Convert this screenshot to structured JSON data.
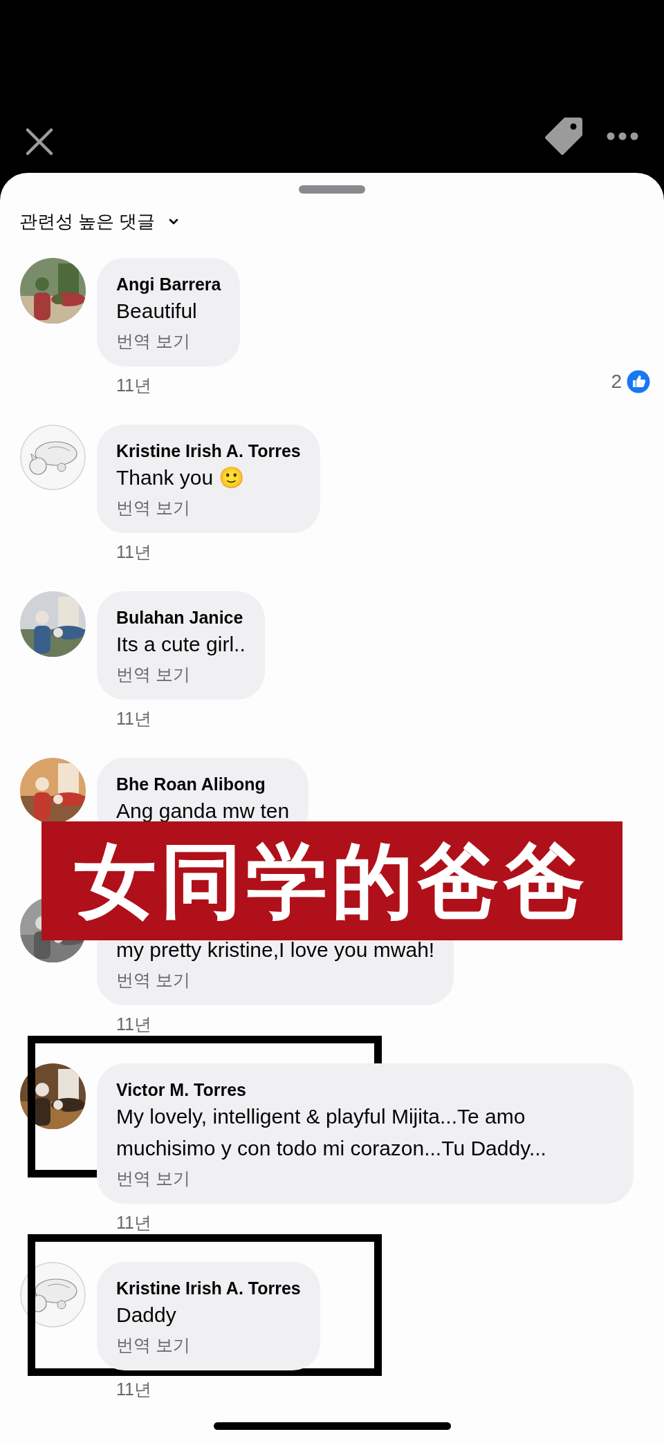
{
  "sort_menu": {
    "label": "관련성 높은 댓글"
  },
  "comments": [
    {
      "author": "Angi Barrera",
      "text": "Beautiful",
      "translate_link": "번역 보기",
      "time": "11년",
      "likes": "2",
      "highlighted": false
    },
    {
      "avatar": {
        "kind": "sketch"
      },
      "author": "Kristine Irish A. Torres",
      "text": "Thank you 🙂",
      "translate_link": "번역 보기",
      "time": "11년",
      "highlighted": false
    },
    {
      "author": "Bulahan Janice",
      "text": "Its a cute girl..",
      "translate_link": "번역 보기",
      "time": "11년",
      "highlighted": false
    },
    {
      "author": "Bhe Roan Alibong",
      "text": "Ang ganda mw ten",
      "highlighted": false
    },
    {
      "text": "my pretty kristine,I love you mwah!",
      "translate_link": "번역 보기",
      "time": "11년",
      "highlighted": false
    },
    {
      "author": "Victor M. Torres",
      "text": "My lovely, intelligent & playful Mijita...Te amo muchisimo y con todo mi corazon...Tu Daddy...",
      "translate_link": "번역 보기",
      "time": "11년",
      "highlighted": true
    },
    {
      "avatar": {
        "kind": "sketch"
      },
      "author": "Kristine Irish A. Torres",
      "text": "Daddy",
      "translate_link": "번역 보기",
      "time": "11년",
      "highlighted": true
    }
  ],
  "overlay_caption": {
    "text": "女同学的爸爸"
  }
}
